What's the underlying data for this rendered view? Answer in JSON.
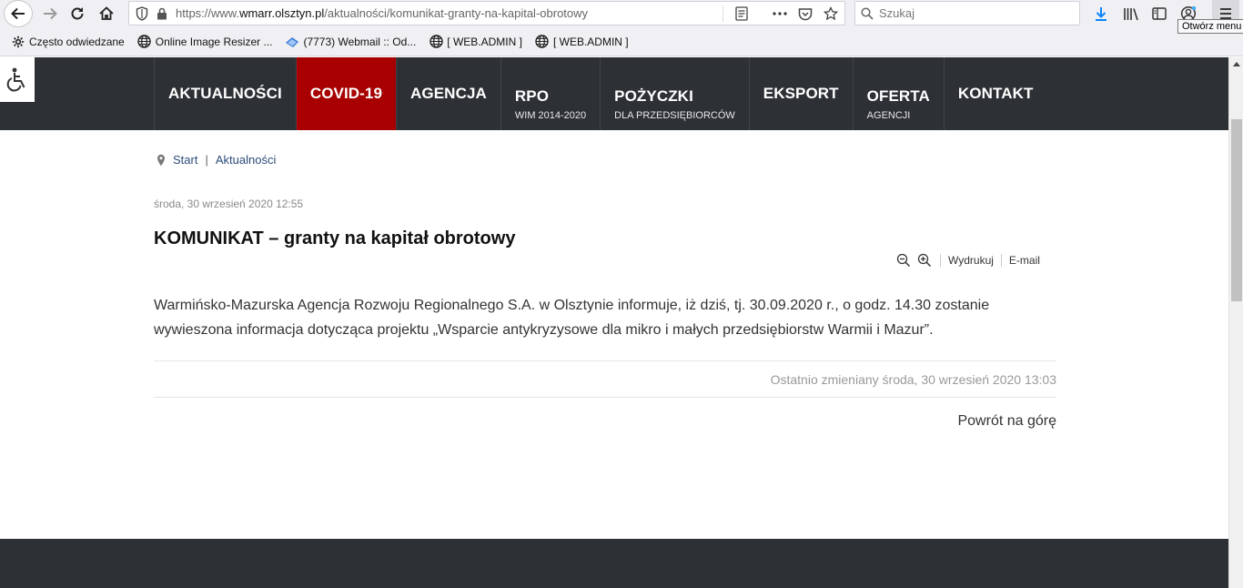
{
  "browser": {
    "url_prefix": "https://www.",
    "url_domain": "wmarr.olsztyn.pl",
    "url_path": "/aktualności/komunikat-granty-na-kapital-obrotowy",
    "search_placeholder": "Szukaj",
    "menu_tooltip": "Otwórz menu",
    "bookmarks": [
      {
        "label": "Często odwiedzane",
        "icon": "gear-icon"
      },
      {
        "label": "Online Image Resizer ...",
        "icon": "globe-icon"
      },
      {
        "label": "(7773) Webmail :: Od...",
        "icon": "webmail-icon"
      },
      {
        "label": "[ WEB.ADMIN ]",
        "icon": "globe-icon"
      },
      {
        "label": "[ WEB.ADMIN ]",
        "icon": "globe-icon"
      }
    ]
  },
  "site": {
    "nav": [
      {
        "label": "AKTUALNOŚCI",
        "sub": ""
      },
      {
        "label": "COVID-19",
        "sub": "",
        "active": true
      },
      {
        "label": "AGENCJA",
        "sub": ""
      },
      {
        "label": "RPO",
        "sub": "WIM 2014-2020"
      },
      {
        "label": "POŻYCZKI",
        "sub": "DLA PRZEDSIĘBIORCÓW"
      },
      {
        "label": "EKSPORT",
        "sub": ""
      },
      {
        "label": "OFERTA",
        "sub": "AGENCJI"
      },
      {
        "label": "KONTAKT",
        "sub": ""
      }
    ],
    "active_color": "#a80000",
    "nav_bg": "#2d3136"
  },
  "breadcrumb": {
    "start": "Start",
    "separator": "|",
    "current": "Aktualności"
  },
  "article": {
    "date": "środa, 30 wrzesień 2020 12:55",
    "title": "KOMUNIKAT – granty na kapitał obrotowy",
    "tools": {
      "print": "Wydrukuj",
      "email": "E-mail"
    },
    "body": "Warmińsko-Mazurska Agencja Rozwoju Regionalnego S.A. w Olsztynie informuje, iż dziś, tj. 30.09.2020 r., o godz. 14.30 zostanie wywieszona informacja dotycząca projektu „Wsparcie antykryzysowe dla mikro i małych przedsiębiorstw Warmii i Mazur”.",
    "modified": "Ostatnio zmieniany środa, 30 wrzesień 2020 13:03",
    "back_to_top": "Powrót na górę"
  }
}
